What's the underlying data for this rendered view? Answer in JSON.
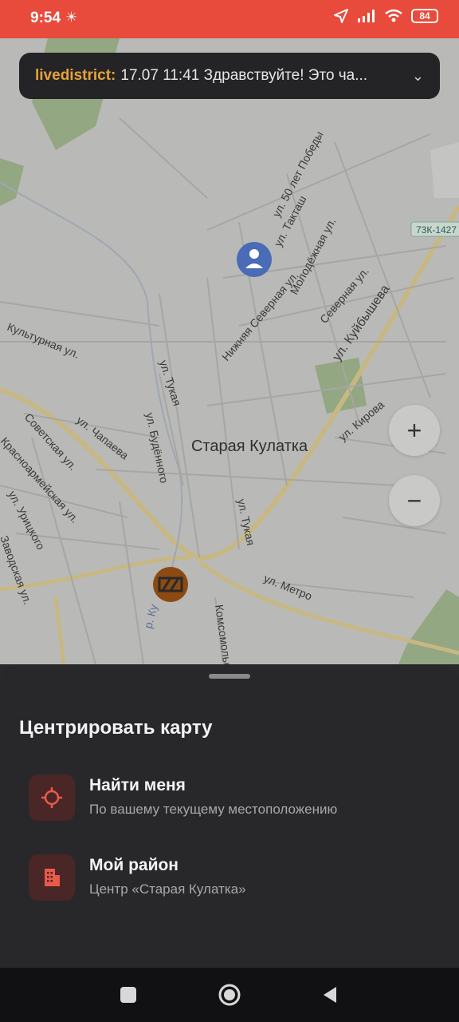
{
  "status_bar": {
    "time": "9:54",
    "battery": "84"
  },
  "notification": {
    "sender": "livedistrict:",
    "text": "17.07 11:41 Здравствуйте! Это ча..."
  },
  "map": {
    "town_label": "Старая Кулатка",
    "road_badge": "73К-1427",
    "streets": [
      "ул. 50 лет Победы",
      "ул. Такташ",
      "Молодёжная ул.",
      "Северная ул.",
      "Нижняя Северная ул.",
      "ул. Куйбышева",
      "Культурная ул.",
      "ул. Тукая",
      "ул. Будённого",
      "Советская ул.",
      "ул. Чапаева",
      "ул. Кирова",
      "ул. Метро",
      "ул. Тукая",
      "Красноармейская ул.",
      "ул. Урицкого",
      "Комсомольская",
      "Заводская ул.",
      "р. Ку"
    ],
    "zoom_in": "+",
    "zoom_out": "−"
  },
  "sheet": {
    "title": "Центрировать карту",
    "options": [
      {
        "title": "Найти меня",
        "subtitle": "По вашему текущему местоположению"
      },
      {
        "title": "Мой район",
        "subtitle": "Центр «Старая Кулатка»"
      }
    ]
  },
  "colors": {
    "accent": "#e84a3b",
    "sheet_bg": "#28282a",
    "icon_bg": "#4a2626",
    "notify_sender": "#e7a23a"
  },
  "icons": [
    "location-arrow-icon",
    "signal-icon",
    "wifi-icon",
    "battery-icon",
    "chevron-down-icon",
    "user-location-icon",
    "roadwork-icon",
    "crosshair-icon",
    "building-icon",
    "nav-square-icon",
    "nav-home-icon",
    "nav-back-icon"
  ]
}
